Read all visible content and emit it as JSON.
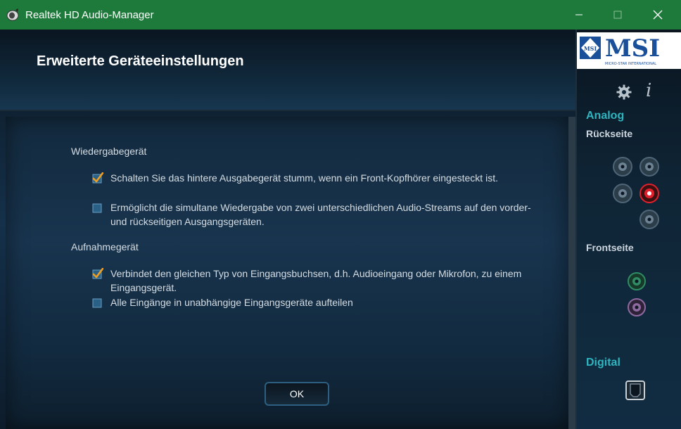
{
  "window": {
    "title": "Realtek HD Audio-Manager",
    "icon": "speaker-app-icon",
    "controls": [
      "minimize-icon",
      "maximize-icon",
      "close-icon"
    ]
  },
  "header": {
    "title": "Erweiterte Geräteeinstellungen"
  },
  "playback": {
    "label": "Wiedergabegerät",
    "options": [
      {
        "label": "Schalten Sie das hintere Ausgabegerät stumm, wenn ein Front-Kopfhörer eingesteckt ist.",
        "checked": true
      },
      {
        "label_line1": "Ermöglicht die simultane Wiedergabe von zwei unterschiedlichen Audio-Streams auf den vorder-",
        "label_line2": "und rückseitigen Ausgangsgeräten.",
        "checked": false
      }
    ]
  },
  "recording": {
    "label": "Aufnahmegerät",
    "options": [
      {
        "label_line1": "Verbindet den gleichen Typ von Eingangsbuchsen, d.h. Audioeingang oder Mikrofon, zu einem",
        "label_line2": "Eingangsgerät.",
        "checked": true
      },
      {
        "label": "Alle Eingänge in unabhängige Eingangsgeräte aufteilen",
        "checked": false
      }
    ]
  },
  "ok_button": {
    "label": "OK"
  },
  "sidebar": {
    "logo_text": "MSI",
    "logo_subtext": "MICRO-STAR INTERNATIONAL",
    "logo_badge": "MSI",
    "analog_label": "Analog",
    "back_label": "Rückseite",
    "front_label": "Frontseite",
    "digital_label": "Digital",
    "icons": [
      "gear-icon",
      "info-icon"
    ],
    "jack_colors": {
      "inactive": "#4f6678",
      "active": "#e0202c",
      "front_green": "#2f8c63",
      "front_pink": "#8f6aa0"
    }
  },
  "colors": {
    "titlebar": "#1d7a3a",
    "accent": "#2fb5c0",
    "checkmark": "#f0a020"
  }
}
